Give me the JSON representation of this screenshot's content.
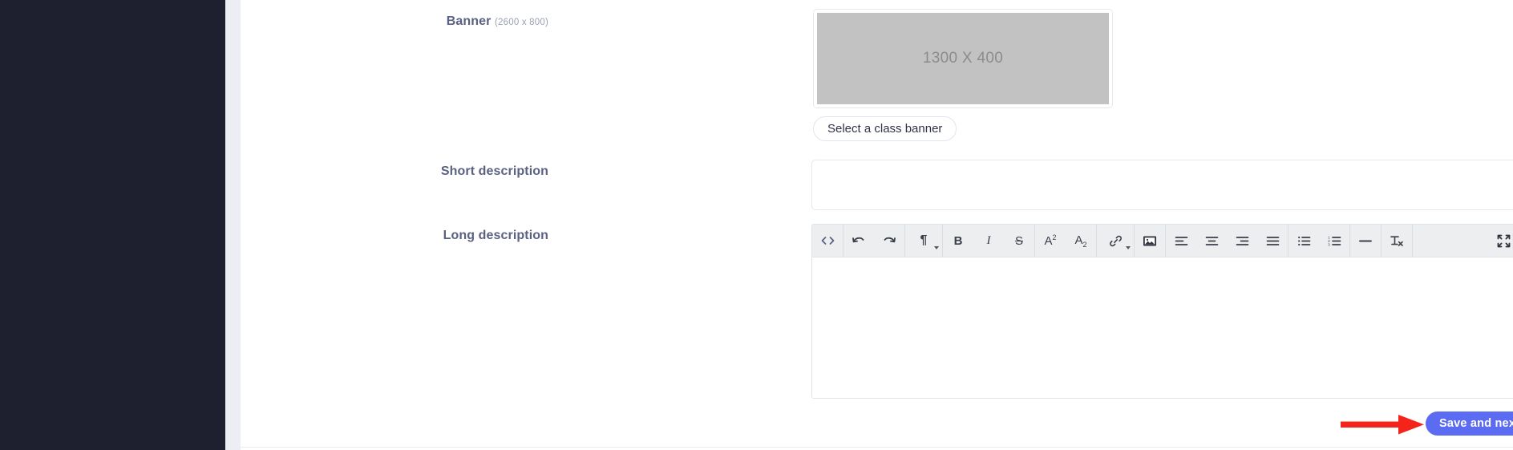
{
  "sidebar": {
    "name": "navigation-sidebar",
    "background": "#1e2030"
  },
  "theme": {
    "accent": "#5c6cf2",
    "label_color": "#5a6182",
    "toolbar_bg": "#eceef0",
    "annotation_arrow_color": "#f5241a"
  },
  "form": {
    "banner": {
      "label": "Banner",
      "dimensions_hint": "(2600 x 800)",
      "placeholder_text": "1300 X 400",
      "select_button_label": "Select a class banner"
    },
    "short_description": {
      "label": "Short description",
      "value": "",
      "placeholder": ""
    },
    "long_description": {
      "label": "Long description",
      "value": "",
      "toolbar": [
        {
          "name": "code-view-icon",
          "title": "Code View",
          "glyph": "<>"
        },
        {
          "name": "undo-icon",
          "title": "Undo"
        },
        {
          "name": "redo-icon",
          "title": "Redo"
        },
        {
          "name": "paragraph-format-icon",
          "title": "Paragraph Format",
          "glyph": "¶",
          "has_dropdown": true
        },
        {
          "name": "bold-icon",
          "title": "Bold",
          "glyph": "B"
        },
        {
          "name": "italic-icon",
          "title": "Italic",
          "glyph": "I"
        },
        {
          "name": "strikethrough-icon",
          "title": "Strikethrough",
          "glyph": "S"
        },
        {
          "name": "superscript-icon",
          "title": "Superscript",
          "glyph": "A2"
        },
        {
          "name": "subscript-icon",
          "title": "Subscript",
          "glyph": "A2"
        },
        {
          "name": "insert-link-icon",
          "title": "Insert Link",
          "has_dropdown": true
        },
        {
          "name": "insert-image-icon",
          "title": "Insert Image"
        },
        {
          "name": "align-left-icon",
          "title": "Align Left"
        },
        {
          "name": "align-center-icon",
          "title": "Align Center"
        },
        {
          "name": "align-right-icon",
          "title": "Align Right"
        },
        {
          "name": "align-justify-icon",
          "title": "Align Justify"
        },
        {
          "name": "unordered-list-icon",
          "title": "Unordered List"
        },
        {
          "name": "ordered-list-icon",
          "title": "Ordered List"
        },
        {
          "name": "horizontal-rule-icon",
          "title": "Insert Horizontal Line"
        },
        {
          "name": "clear-formatting-icon",
          "title": "Clear Formatting"
        },
        {
          "name": "fullscreen-icon",
          "title": "Fullscreen"
        }
      ]
    }
  },
  "footer": {
    "save_button_label": "Save and next",
    "save_button_arrow": "→"
  },
  "annotation": {
    "arrow_name": "red-pointer-arrow",
    "points_to": "Save and next"
  }
}
